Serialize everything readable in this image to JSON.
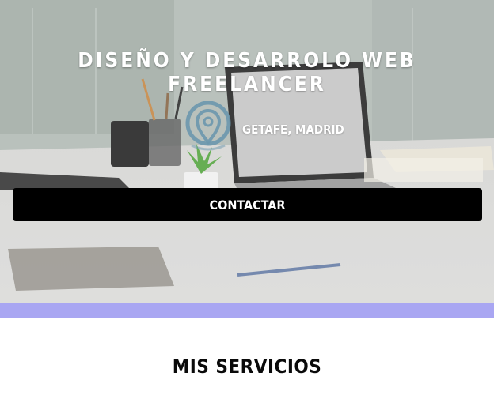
{
  "hero": {
    "title": "DISEÑO Y DESARROLO WEB FREELANCER",
    "location_text": "GETAFE, MADRID",
    "contact_label": "CONTACTAR"
  },
  "icons": {
    "location": "map-pin-icon"
  },
  "colors": {
    "button_bg": "#000000",
    "accent_bar": "#a9a6f2",
    "pin": "#6b97ad"
  },
  "services": {
    "title": "MIS SERVICIOS"
  }
}
